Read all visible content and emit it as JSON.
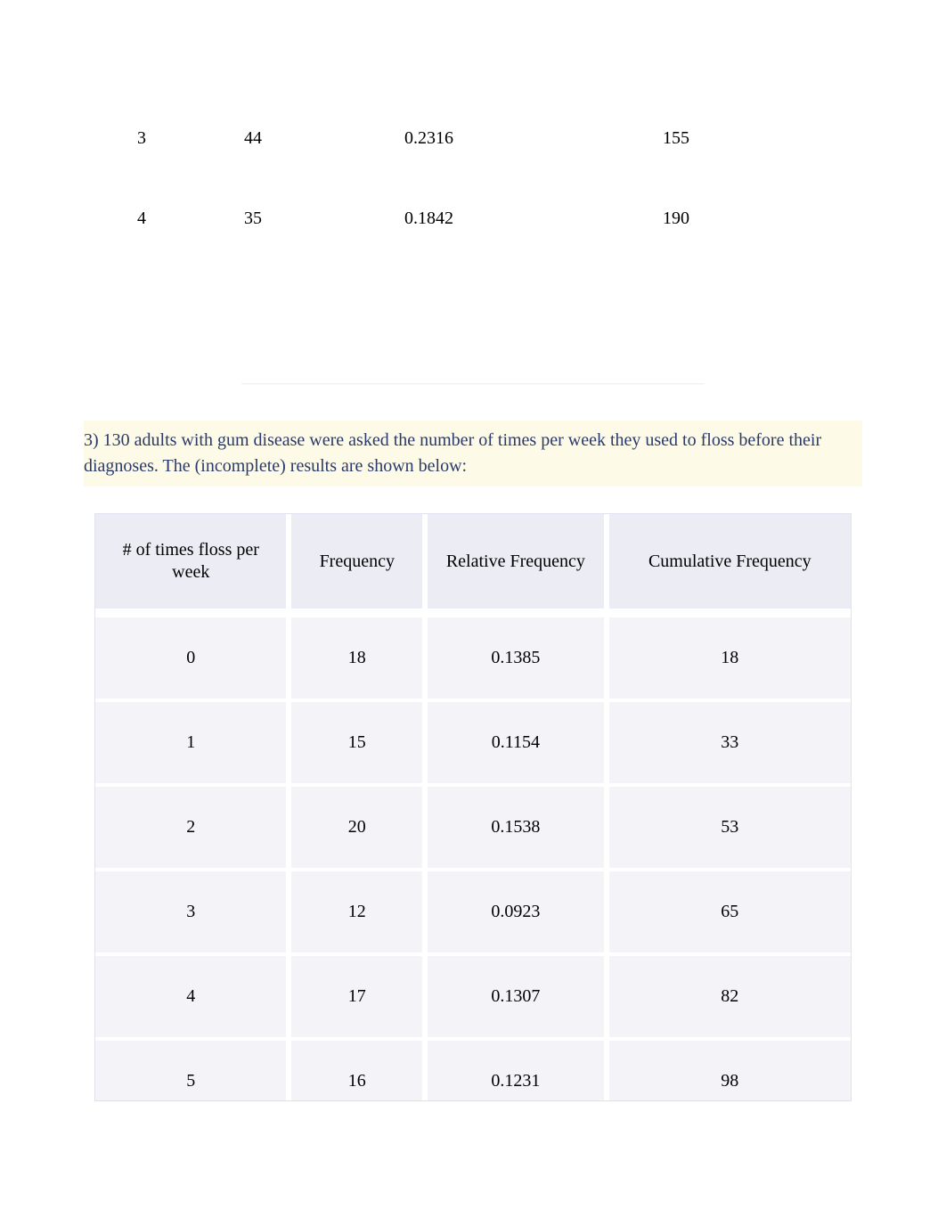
{
  "top_rows": [
    {
      "c1": "3",
      "c2": "44",
      "c3": "0.2316",
      "c4": "155"
    },
    {
      "c1": "4",
      "c2": "35",
      "c3": "0.1842",
      "c4": "190"
    }
  ],
  "question_text": "3) 130 adults with gum disease were asked the number of times per week they used to floss before their diagnoses. The (incomplete) results are shown below:",
  "table": {
    "headers": {
      "col1": "# of times floss per week",
      "col2": "Frequency",
      "col3": "Relative Frequency",
      "col4": "Cumulative Frequency"
    },
    "rows": [
      {
        "col1": "0",
        "col2": "18",
        "col3": "0.1385",
        "col4": "18"
      },
      {
        "col1": "1",
        "col2": "15",
        "col3": "0.1154",
        "col4": "33"
      },
      {
        "col1": "2",
        "col2": "20",
        "col3": "0.1538",
        "col4": "53"
      },
      {
        "col1": "3",
        "col2": "12",
        "col3": "0.0923",
        "col4": "65"
      },
      {
        "col1": "4",
        "col2": "17",
        "col3": "0.1307",
        "col4": "82"
      },
      {
        "col1": "5",
        "col2": "16",
        "col3": "0.1231",
        "col4": "98"
      }
    ]
  }
}
